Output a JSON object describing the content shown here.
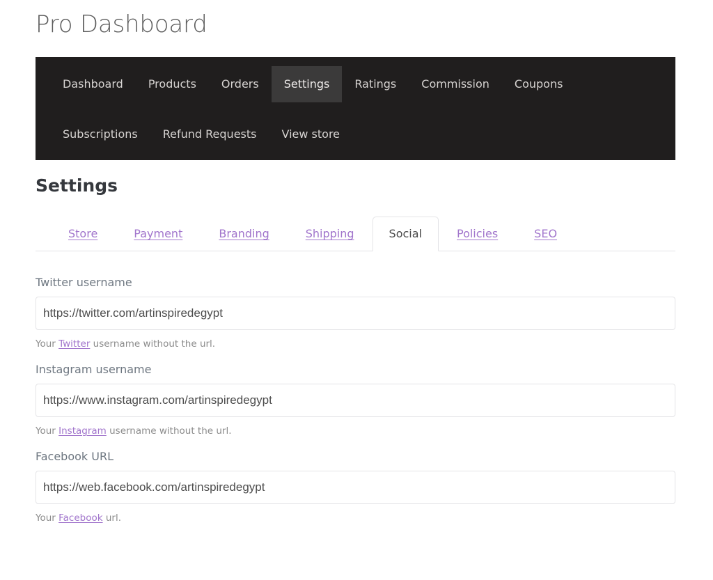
{
  "header": {
    "title": "Pro Dashboard"
  },
  "nav": {
    "rows": [
      [
        {
          "label": "Dashboard",
          "active": false
        },
        {
          "label": "Products",
          "active": false
        },
        {
          "label": "Orders",
          "active": false
        },
        {
          "label": "Settings",
          "active": true
        },
        {
          "label": "Ratings",
          "active": false
        },
        {
          "label": "Commission",
          "active": false
        },
        {
          "label": "Coupons",
          "active": false
        }
      ],
      [
        {
          "label": "Subscriptions",
          "active": false
        },
        {
          "label": "Refund Requests",
          "active": false
        },
        {
          "label": "View store",
          "active": false
        }
      ]
    ]
  },
  "section": {
    "heading": "Settings"
  },
  "tabs": [
    {
      "label": "Store",
      "active": false
    },
    {
      "label": "Payment",
      "active": false
    },
    {
      "label": "Branding",
      "active": false
    },
    {
      "label": "Shipping",
      "active": false
    },
    {
      "label": "Social",
      "active": true
    },
    {
      "label": "Policies",
      "active": false
    },
    {
      "label": "SEO",
      "active": false
    }
  ],
  "fields": [
    {
      "label": "Twitter username",
      "value": "https://twitter.com/artinspiredegypt",
      "placeholder": "",
      "help_before": "Your ",
      "help_link": "Twitter",
      "help_after": " username without the url."
    },
    {
      "label": "Instagram username",
      "value": "https://www.instagram.com/artinspiredegypt",
      "placeholder": "",
      "help_before": "Your ",
      "help_link": "Instagram",
      "help_after": " username without the url."
    },
    {
      "label": "Facebook URL",
      "value": "https://web.facebook.com/artinspiredegypt",
      "placeholder": "",
      "help_before": "Your ",
      "help_link": "Facebook",
      "help_after": " url."
    }
  ],
  "colors": {
    "nav_background": "#201e1e",
    "nav_active_background": "#3b3a3a",
    "link_purple": "#a175cc",
    "heading": "#35383d",
    "label": "#6e7781",
    "border": "#e3e3e6"
  }
}
